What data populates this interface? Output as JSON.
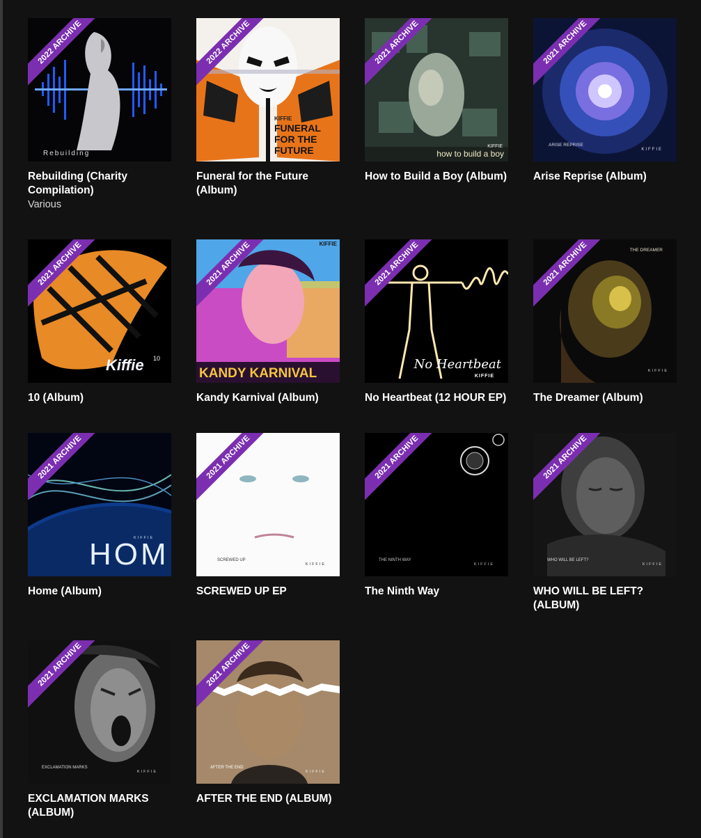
{
  "albums": [
    {
      "title": "Rebuilding (Charity Compilation)",
      "subtitle": "Various",
      "badge": "2022 ARCHIVE",
      "cover_text": "Rebuilding",
      "cover_text2": ""
    },
    {
      "title": "Funeral for the Future (Album)",
      "subtitle": "",
      "badge": "2022 ARCHIVE",
      "cover_text": "FUNERAL FOR THE FUTURE",
      "cover_text2": "KIFFIE"
    },
    {
      "title": "How to Build a Boy (Album)",
      "subtitle": "",
      "badge": "2021 ARCHIVE",
      "cover_text": "how to build a boy",
      "cover_text2": "KIFFIE"
    },
    {
      "title": "Arise Reprise (Album)",
      "subtitle": "",
      "badge": "2021 ARCHIVE",
      "cover_text": "ARISE REPRISE",
      "cover_text2": "KIFFIE"
    },
    {
      "title": "10 (Album)",
      "subtitle": "",
      "badge": "2021 ARCHIVE",
      "cover_text": "Kiffie",
      "cover_text2": "10"
    },
    {
      "title": "Kandy Karnival (Album)",
      "subtitle": "",
      "badge": "2021 ARCHIVE",
      "cover_text": "KANDY KARNIVAL",
      "cover_text2": "KIFFIE"
    },
    {
      "title": "No Heartbeat (12 HOUR EP)",
      "subtitle": "",
      "badge": "2021 ARCHIVE",
      "cover_text": "No Heartbeat",
      "cover_text2": "KIFFIE"
    },
    {
      "title": "The Dreamer (Album)",
      "subtitle": "",
      "badge": "2021 ARCHIVE",
      "cover_text": "THE DREAMER",
      "cover_text2": "KIFFIE"
    },
    {
      "title": "Home (Album)",
      "subtitle": "",
      "badge": "2021 ARCHIVE",
      "cover_text": "HOME",
      "cover_text2": "KIFFIE"
    },
    {
      "title": "SCREWED UP EP",
      "subtitle": "",
      "badge": "2021 ARCHIVE",
      "cover_text": "SCREWED UP",
      "cover_text2": "KIFFIE"
    },
    {
      "title": "The Ninth Way",
      "subtitle": "",
      "badge": "2021 ARCHIVE",
      "cover_text": "THE NINTH WAY",
      "cover_text2": "KIFFIE"
    },
    {
      "title": "WHO WILL BE LEFT? (ALBUM)",
      "subtitle": "",
      "badge": "2021 ARCHIVE",
      "cover_text": "WHO WILL BE LEFT?",
      "cover_text2": "KIFFIE"
    },
    {
      "title": "EXCLAMATION MARKS (ALBUM)",
      "subtitle": "",
      "badge": "2021 ARCHIVE",
      "cover_text": "EXCLAMATION MARKS",
      "cover_text2": "KIFFIE"
    },
    {
      "title": "AFTER THE END (ALBUM)",
      "subtitle": "",
      "badge": "2021 ARCHIVE",
      "cover_text": "AFTER THE END",
      "cover_text2": "KIFFIE"
    }
  ]
}
